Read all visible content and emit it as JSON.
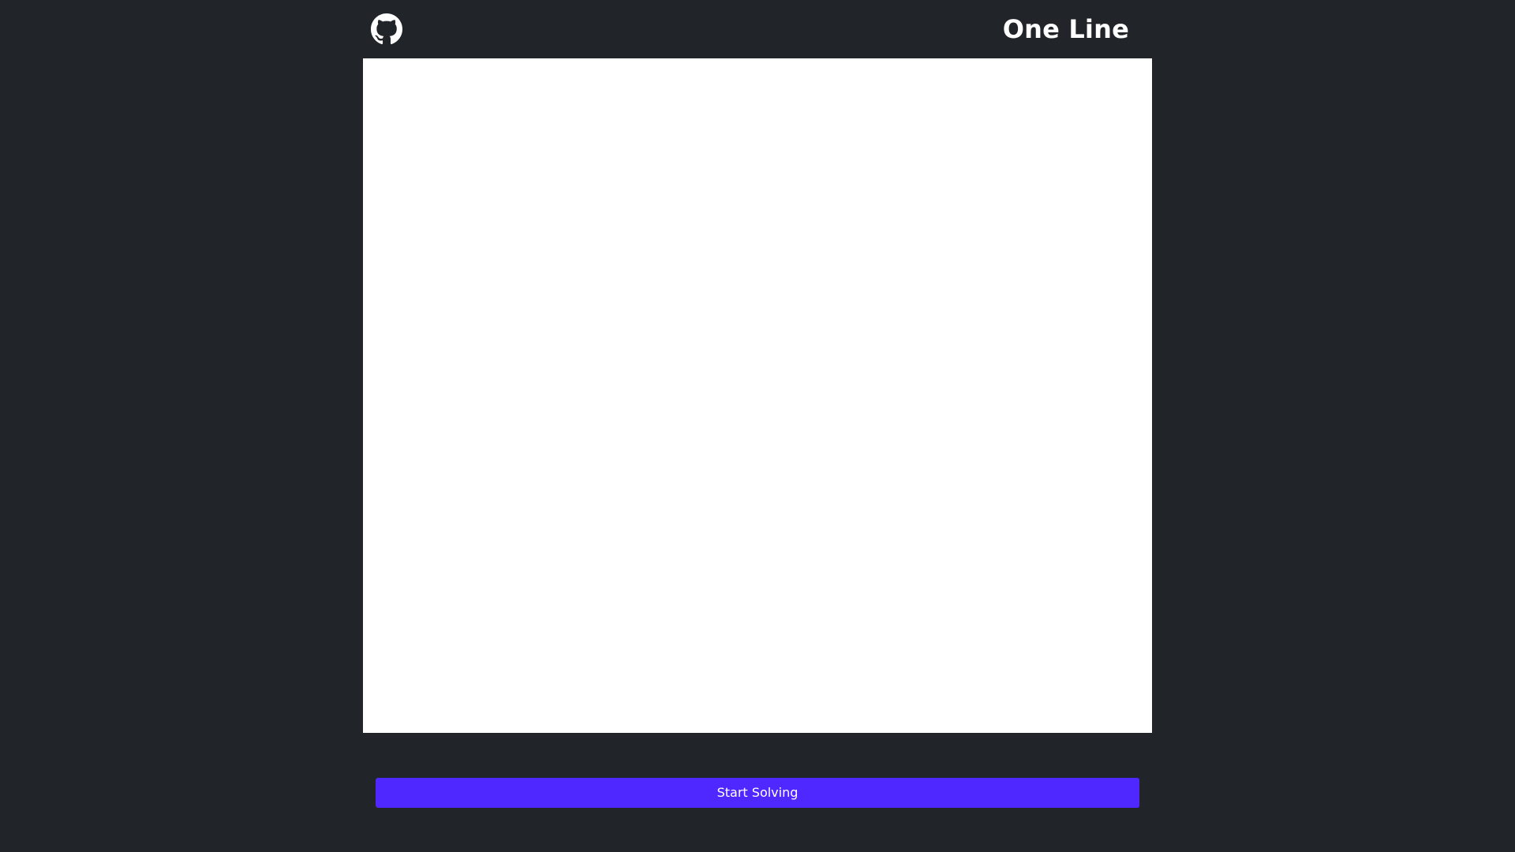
{
  "header": {
    "github_icon": "github-icon",
    "title": "One Line"
  },
  "board": {
    "background": "#ffffff"
  },
  "actions": {
    "start_label": "Start Solving",
    "start_color": "#4f27ff"
  },
  "theme": {
    "page_background": "#212429",
    "text_color": "#ffffff"
  }
}
